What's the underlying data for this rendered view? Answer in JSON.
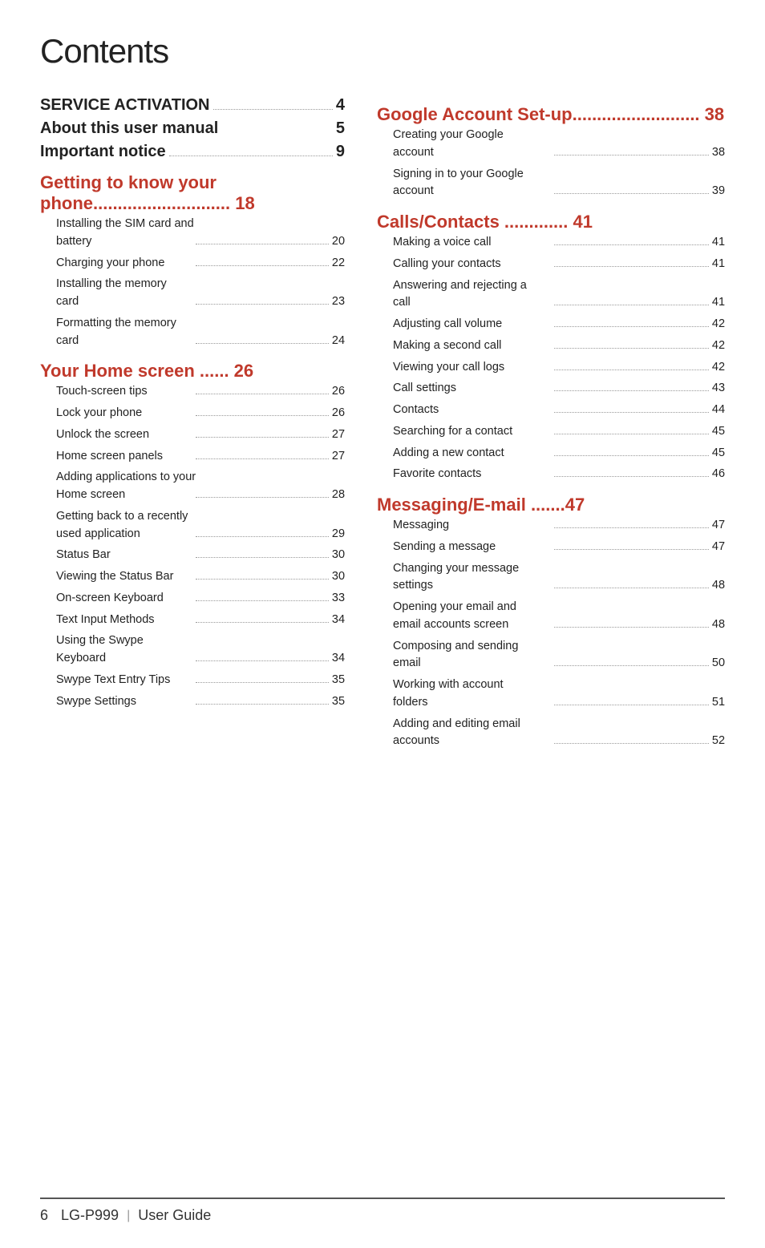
{
  "title": "Contents",
  "left_col": [
    {
      "type": "top",
      "text": "SERVICE ACTIVATION",
      "page": "4",
      "dots": true
    },
    {
      "type": "top",
      "text": "About this user manual",
      "page": "5",
      "dots": false
    },
    {
      "type": "top",
      "text": "Important notice",
      "page": "9",
      "dots": true
    },
    {
      "type": "section",
      "text": "Getting to know your phone............................ 18"
    },
    {
      "type": "sub_multi",
      "lines": [
        "Installing the SIM card and",
        "battery"
      ],
      "dots": true,
      "page": "20"
    },
    {
      "type": "sub",
      "text": "Charging your phone",
      "dots": true,
      "page": "22"
    },
    {
      "type": "sub_multi",
      "lines": [
        "Installing the memory",
        "card"
      ],
      "dots": true,
      "page": "23"
    },
    {
      "type": "sub_multi",
      "lines": [
        "Formatting the memory",
        "card"
      ],
      "dots": true,
      "page": "24"
    },
    {
      "type": "section",
      "text": "Your Home screen ...... 26"
    },
    {
      "type": "sub",
      "text": "Touch-screen tips",
      "dots": true,
      "page": "26"
    },
    {
      "type": "sub",
      "text": "Lock your phone",
      "dots": true,
      "page": "26"
    },
    {
      "type": "sub",
      "text": "Unlock the screen",
      "dots": true,
      "page": "27"
    },
    {
      "type": "sub",
      "text": "Home screen panels",
      "dots": true,
      "page": "27"
    },
    {
      "type": "sub_multi",
      "lines": [
        "Adding applications to your",
        "Home screen"
      ],
      "dots": true,
      "page": "28"
    },
    {
      "type": "sub_multi",
      "lines": [
        "Getting back to a recently",
        "used application"
      ],
      "dots": true,
      "page": "29"
    },
    {
      "type": "sub",
      "text": "Status Bar",
      "dots": true,
      "page": "30"
    },
    {
      "type": "sub",
      "text": "Viewing the Status Bar",
      "dots": true,
      "page": "30"
    },
    {
      "type": "sub",
      "text": "On-screen Keyboard",
      "dots": true,
      "page": "33"
    },
    {
      "type": "sub",
      "text": "Text Input Methods",
      "dots": true,
      "page": "34"
    },
    {
      "type": "sub_multi",
      "lines": [
        "Using the Swype",
        "Keyboard"
      ],
      "dots": true,
      "page": "34"
    },
    {
      "type": "sub",
      "text": "Swype Text Entry Tips",
      "dots": true,
      "page": "35"
    },
    {
      "type": "sub",
      "text": "Swype Settings",
      "dots": true,
      "page": "35"
    }
  ],
  "right_col": [
    {
      "type": "section2",
      "text": "Google Account Set-up.......................... 38"
    },
    {
      "type": "sub_multi",
      "lines": [
        "Creating your Google",
        "account"
      ],
      "dots": true,
      "page": "38"
    },
    {
      "type": "sub_multi",
      "lines": [
        "Signing in to your Google",
        "account"
      ],
      "dots": true,
      "page": "39"
    },
    {
      "type": "section",
      "text": "Calls/Contacts ............. 41"
    },
    {
      "type": "sub",
      "text": "Making a voice call",
      "dots": true,
      "page": "41"
    },
    {
      "type": "sub",
      "text": "Calling your contacts",
      "dots": true,
      "page": "41"
    },
    {
      "type": "sub_multi",
      "lines": [
        "Answering and rejecting a",
        "call"
      ],
      "dots": true,
      "page": "41"
    },
    {
      "type": "sub",
      "text": "Adjusting call volume",
      "dots": true,
      "page": "42"
    },
    {
      "type": "sub",
      "text": "Making a second call",
      "dots": true,
      "page": "42"
    },
    {
      "type": "sub",
      "text": "Viewing your call logs",
      "dots": true,
      "page": "42"
    },
    {
      "type": "sub",
      "text": "Call settings",
      "dots": true,
      "page": "43"
    },
    {
      "type": "sub",
      "text": "Contacts",
      "dots": true,
      "page": "44"
    },
    {
      "type": "sub",
      "text": "Searching for a contact",
      "dots": true,
      "page": "45"
    },
    {
      "type": "sub",
      "text": "Adding a new contact",
      "dots": true,
      "page": "45"
    },
    {
      "type": "sub",
      "text": "Favorite contacts",
      "dots": true,
      "page": "46"
    },
    {
      "type": "section",
      "text": "Messaging/E-mail .......47"
    },
    {
      "type": "sub",
      "text": "Messaging",
      "dots": true,
      "page": "47"
    },
    {
      "type": "sub",
      "text": "Sending a message",
      "dots": true,
      "page": "47"
    },
    {
      "type": "sub_multi",
      "lines": [
        "Changing your message",
        "settings"
      ],
      "dots": true,
      "page": "48"
    },
    {
      "type": "sub_multi",
      "lines": [
        "Opening your email and",
        "email accounts screen"
      ],
      "dots": true,
      "page": "48"
    },
    {
      "type": "sub_multi",
      "lines": [
        "Composing and sending",
        "email"
      ],
      "dots": true,
      "page": "50"
    },
    {
      "type": "sub_multi",
      "lines": [
        "Working with account",
        "folders"
      ],
      "dots": true,
      "page": "51"
    },
    {
      "type": "sub_multi",
      "lines": [
        "Adding and editing email",
        "accounts"
      ],
      "dots": true,
      "page": "52"
    }
  ],
  "footer": {
    "page": "6",
    "brand": "LG-P999",
    "separator": "|",
    "text": "User Guide"
  }
}
